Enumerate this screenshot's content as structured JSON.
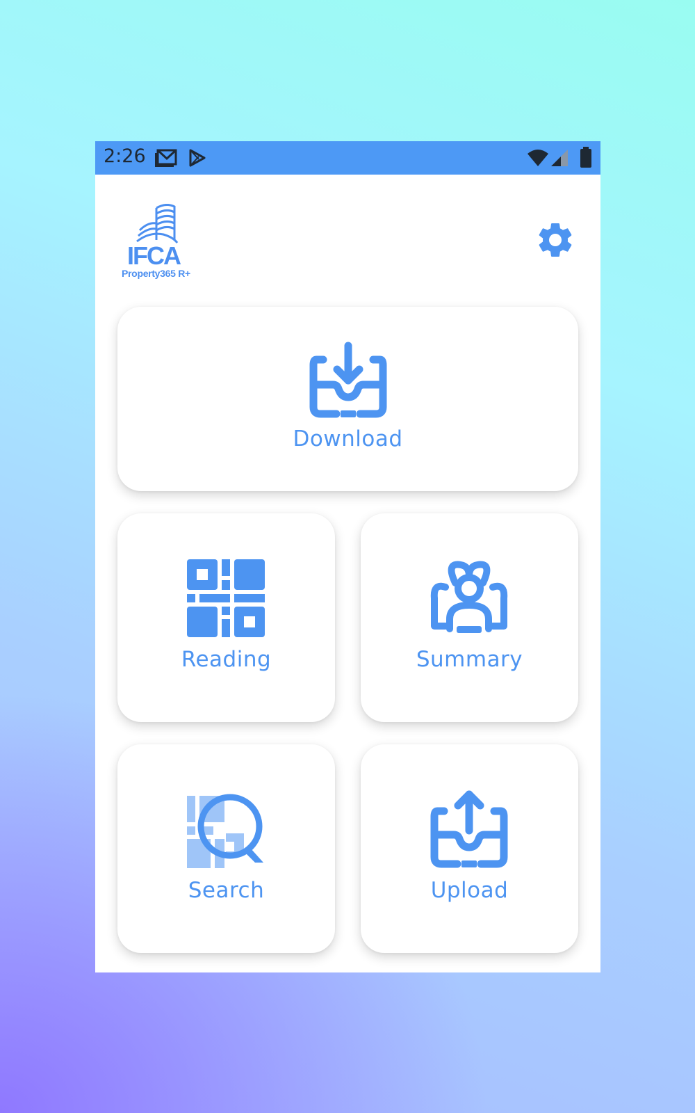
{
  "status_bar": {
    "time": "2:26",
    "icons": [
      "gmail-icon",
      "play-store-icon",
      "wifi-icon",
      "signal-icon",
      "battery-icon"
    ]
  },
  "header": {
    "logo_text": "IFCA",
    "logo_subtext": "Property365 R+",
    "settings_icon": "gear-icon"
  },
  "menu": {
    "download": {
      "label": "Download",
      "icon": "inbox-download-icon"
    },
    "reading": {
      "label": "Reading",
      "icon": "qr-code-icon"
    },
    "summary": {
      "label": "Summary",
      "icon": "users-group-icon"
    },
    "search": {
      "label": "Search",
      "icon": "qr-search-icon"
    },
    "upload": {
      "label": "Upload",
      "icon": "inbox-upload-icon"
    }
  },
  "colors": {
    "accent": "#4d94f1",
    "status_bar": "#4d99f5",
    "card_background": "#ffffff"
  }
}
